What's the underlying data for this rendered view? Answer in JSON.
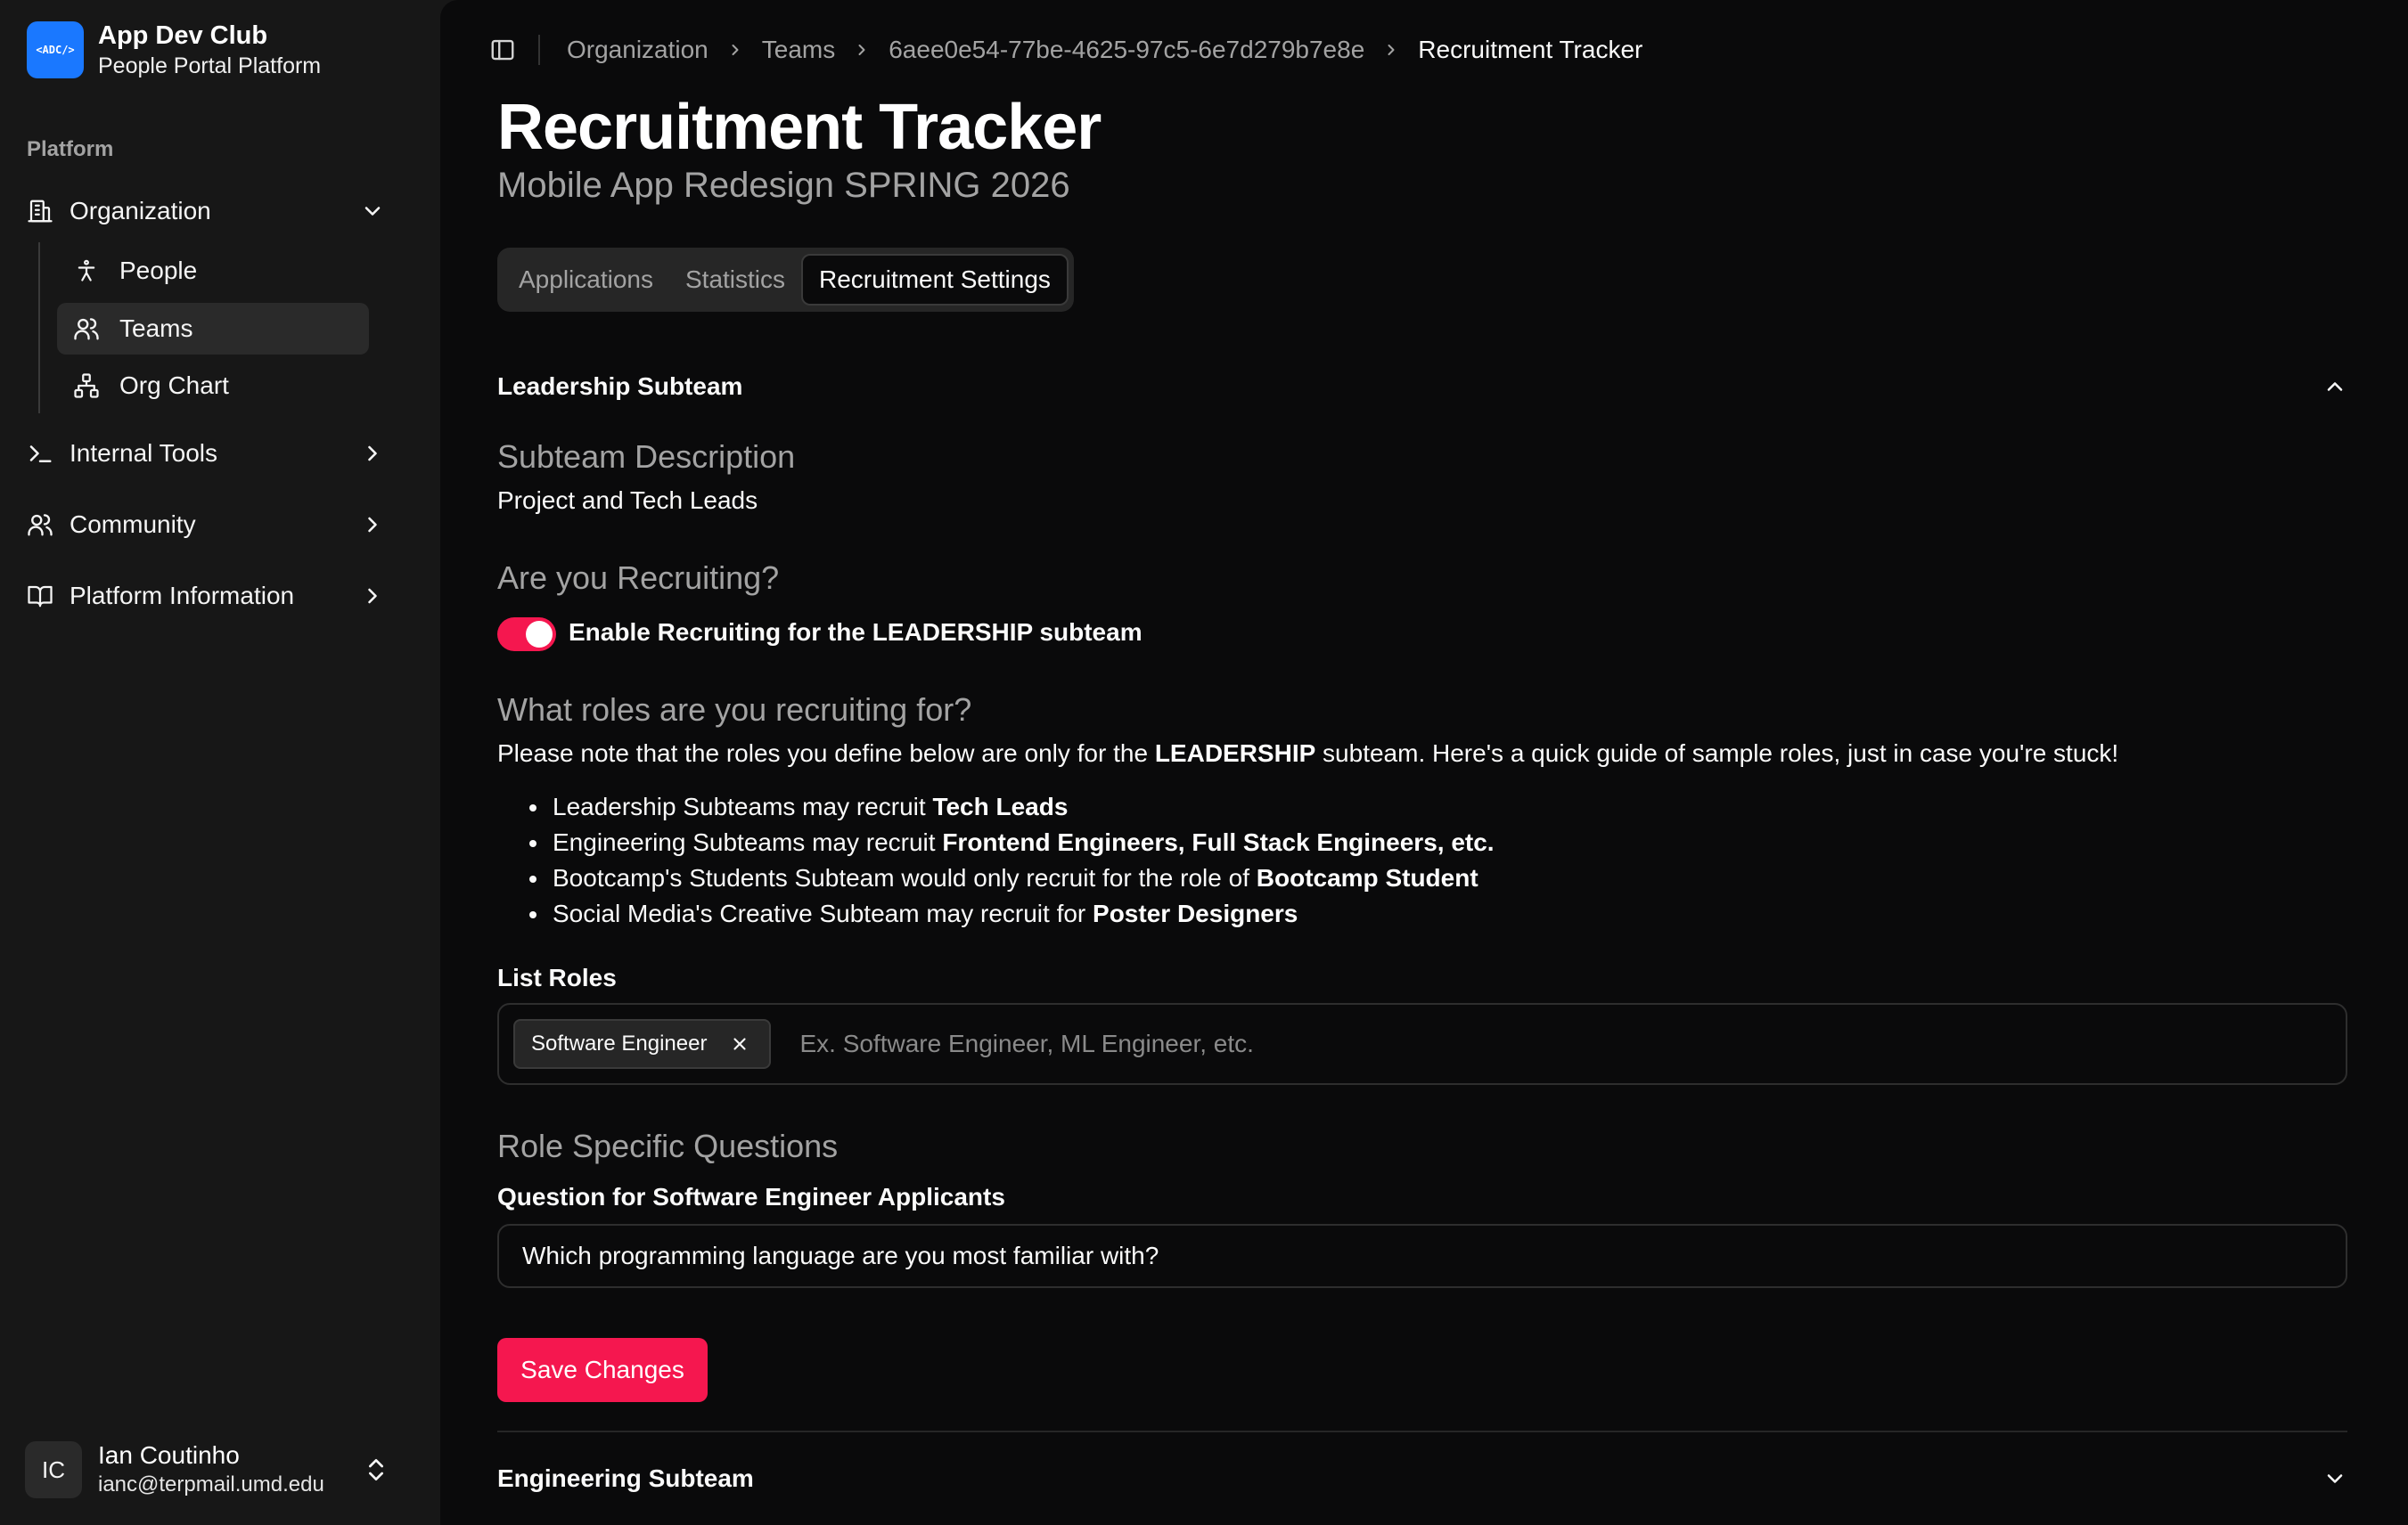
{
  "brand": {
    "logo_text": "<ADC/>",
    "name": "App Dev Club",
    "subtitle": "People Portal Platform"
  },
  "sidebar": {
    "section_label": "Platform",
    "items": [
      {
        "label": "Organization",
        "icon": "building-icon",
        "expanded": true,
        "children": [
          {
            "label": "People",
            "icon": "person-icon"
          },
          {
            "label": "Teams",
            "icon": "users-icon",
            "active": true
          },
          {
            "label": "Org Chart",
            "icon": "network-icon"
          }
        ]
      },
      {
        "label": "Internal Tools",
        "icon": "terminal-icon"
      },
      {
        "label": "Community",
        "icon": "users-icon"
      },
      {
        "label": "Platform Information",
        "icon": "book-icon"
      }
    ]
  },
  "user": {
    "initials": "IC",
    "name": "Ian Coutinho",
    "email": "ianc@terpmail.umd.edu"
  },
  "breadcrumb": [
    "Organization",
    "Teams",
    "6aee0e54-77be-4625-97c5-6e7d279b7e8e",
    "Recruitment Tracker"
  ],
  "page": {
    "title": "Recruitment Tracker",
    "subtitle": "Mobile App Redesign SPRING 2026"
  },
  "tabs": [
    {
      "label": "Applications",
      "active": false
    },
    {
      "label": "Statistics",
      "active": false
    },
    {
      "label": "Recruitment Settings",
      "active": true
    }
  ],
  "leadership": {
    "title": "Leadership Subteam",
    "description_heading": "Subteam Description",
    "description": "Project and Tech Leads",
    "recruiting_heading": "Are you Recruiting?",
    "toggle_on": true,
    "toggle_label": "Enable Recruiting for the LEADERSHIP subteam",
    "roles_heading": "What roles are you recruiting for?",
    "note_pre": "Please note that the roles you define below are only for the ",
    "note_bold": "LEADERSHIP",
    "note_post": " subteam. Here's a quick guide of sample roles, just in case you're stuck!",
    "guide": [
      {
        "text": "Leadership Subteams may recruit ",
        "bold": "Tech Leads"
      },
      {
        "text": "Engineering Subteams may recruit ",
        "bold": "Frontend Engineers, Full Stack Engineers, etc."
      },
      {
        "text": "Bootcamp's Students Subteam would only recruit for the role of ",
        "bold": "Bootcamp Student"
      },
      {
        "text": "Social Media's Creative Subteam may recruit for ",
        "bold": "Poster Designers"
      }
    ],
    "list_roles_label": "List Roles",
    "roles": [
      "Software Engineer"
    ],
    "roles_placeholder": "Ex. Software Engineer, ML Engineer, etc.",
    "questions_heading": "Role Specific Questions",
    "question_label": "Question for Software Engineer Applicants",
    "question_value": "Which programming language are you most familiar with?",
    "save_label": "Save Changes"
  },
  "engineering": {
    "title": "Engineering Subteam"
  },
  "colors": {
    "accent": "#f5174f",
    "brand": "#1a78ff",
    "sidebar_bg": "#171717",
    "main_bg": "#0a0a0b"
  }
}
